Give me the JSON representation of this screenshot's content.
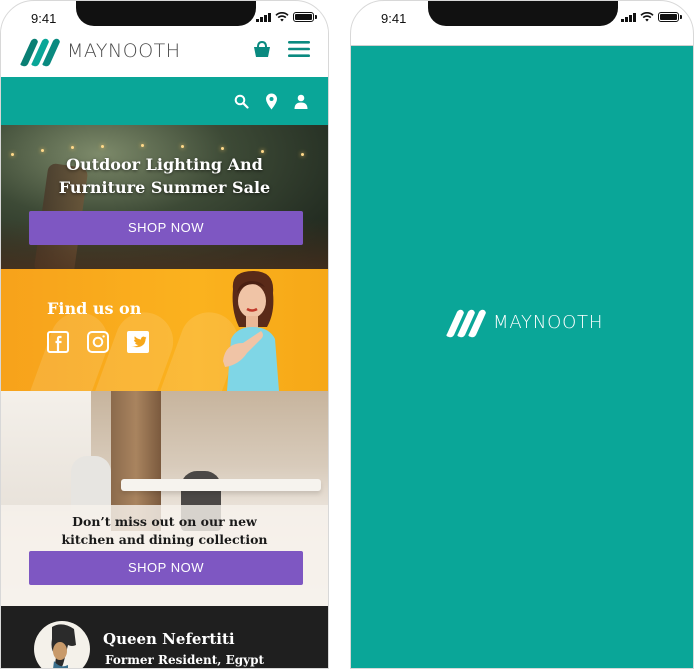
{
  "left_screen": {
    "status": {
      "time": "9:41"
    },
    "header": {
      "brand": "MAYNOOTH",
      "cart_icon": "cart-icon",
      "menu_icon": "hamburger-menu-icon"
    },
    "nav_icons": [
      "search-icon",
      "location-pin-icon",
      "user-icon"
    ],
    "hero": {
      "title_line1": "Outdoor Lighting And",
      "title_line2": "Furniture Summer Sale",
      "button": "SHOP NOW"
    },
    "social": {
      "title": "Find us on",
      "icons": [
        "facebook-icon",
        "instagram-icon",
        "twitter-icon"
      ]
    },
    "dining": {
      "title_line1": "Don’t miss out on our new",
      "title_line2": "kitchen and dining collection",
      "button": "SHOP NOW"
    },
    "testimonial": {
      "name": "Queen Nefertiti",
      "role": "Former Resident, Egypt"
    }
  },
  "right_screen": {
    "status": {
      "time": "9:41"
    },
    "splash": {
      "brand": "MAYNOOTH"
    }
  },
  "colors": {
    "teal": "#0aa698",
    "purple": "#7e57c2",
    "orange": "#fbb21e",
    "dark": "#1f1f1f"
  }
}
